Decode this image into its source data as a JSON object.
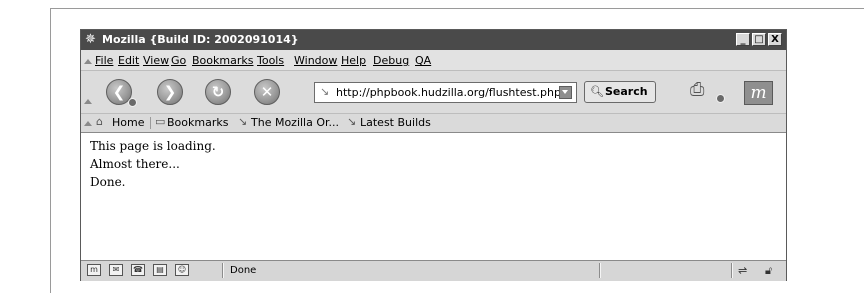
{
  "window": {
    "title": "Mozilla {Build ID: 2002091014}",
    "app_icon": "mozilla-icon",
    "minimize_label": "_",
    "maximize_label": "□",
    "close_label": "X"
  },
  "menubar": {
    "items": [
      "File",
      "Edit",
      "View",
      "Go",
      "Bookmarks",
      "Tools",
      "Window",
      "Help",
      "Debug",
      "QA"
    ]
  },
  "navbar": {
    "back_icon": "back-icon",
    "forward_icon": "forward-icon",
    "reload_icon": "reload-icon",
    "stop_icon": "stop-icon",
    "url": "http://phpbook.hudzilla.org/flushtest.php",
    "search_label": "Search",
    "print_icon": "print-icon",
    "throbber_icon": "mozilla-m-icon"
  },
  "personal_toolbar": {
    "items": [
      {
        "label": "Home",
        "icon": "home-icon"
      },
      {
        "label": "Bookmarks",
        "icon": "folder-icon"
      },
      {
        "label": "The Mozilla Or...",
        "icon": "bookmark-icon"
      },
      {
        "label": "Latest Builds",
        "icon": "bookmark-icon"
      }
    ]
  },
  "content": {
    "lines": [
      "This page is loading.",
      "Almost there...",
      "Done."
    ]
  },
  "statusbar": {
    "status_text": "Done",
    "left_icons": [
      "navigator-icon",
      "mail-icon",
      "addressbook-icon",
      "composer-icon",
      "irc-icon"
    ],
    "right_icons": [
      "connection-icon",
      "lock-icon"
    ]
  },
  "colors": {
    "titlebar": "#4a4a4a",
    "chrome": "#dcdcdc",
    "content_bg": "#ffffff"
  }
}
